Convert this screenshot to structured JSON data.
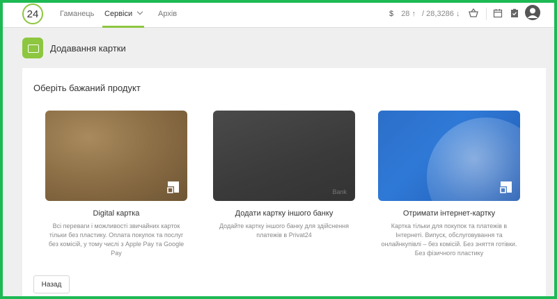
{
  "header": {
    "logo_text": "24",
    "nav": [
      {
        "label": "Гаманець"
      },
      {
        "label": "Сервіси"
      },
      {
        "label": "Архів"
      }
    ],
    "rates": {
      "currency": "$",
      "buy": "28 ↑",
      "sell": "/ 28,3286 ↓"
    },
    "icons": [
      "basket-icon",
      "calendar-icon",
      "tasks-icon",
      "avatar-icon"
    ]
  },
  "page": {
    "title": "Додавання картки"
  },
  "panel": {
    "heading": "Оберіть бажаний продукт",
    "products": [
      {
        "title": "Digital картка",
        "description": "Всі переваги і можливості звичайних карток тільки без пластику. Оплата покупок та послуг без комісій, у тому числі з Apple Pay та Google Pay",
        "card_style": "gold"
      },
      {
        "title": "Додати картку іншого банку",
        "description": "Додайте картку іншого банку для здійснення платежів в Privat24",
        "card_style": "dark",
        "card_text": "Bank"
      },
      {
        "title": "Отримати інтернет-картку",
        "description": "Картка тільки для покупок та платежів в Інтернеті. Випуск, обслуговування та онлайнкупівлі – без комісій. Без зняття готівки. Без фізичного пластику",
        "card_style": "blue"
      }
    ],
    "back_label": "Назад"
  },
  "colors": {
    "accent": "#8dc63f",
    "border": "#1db954"
  }
}
